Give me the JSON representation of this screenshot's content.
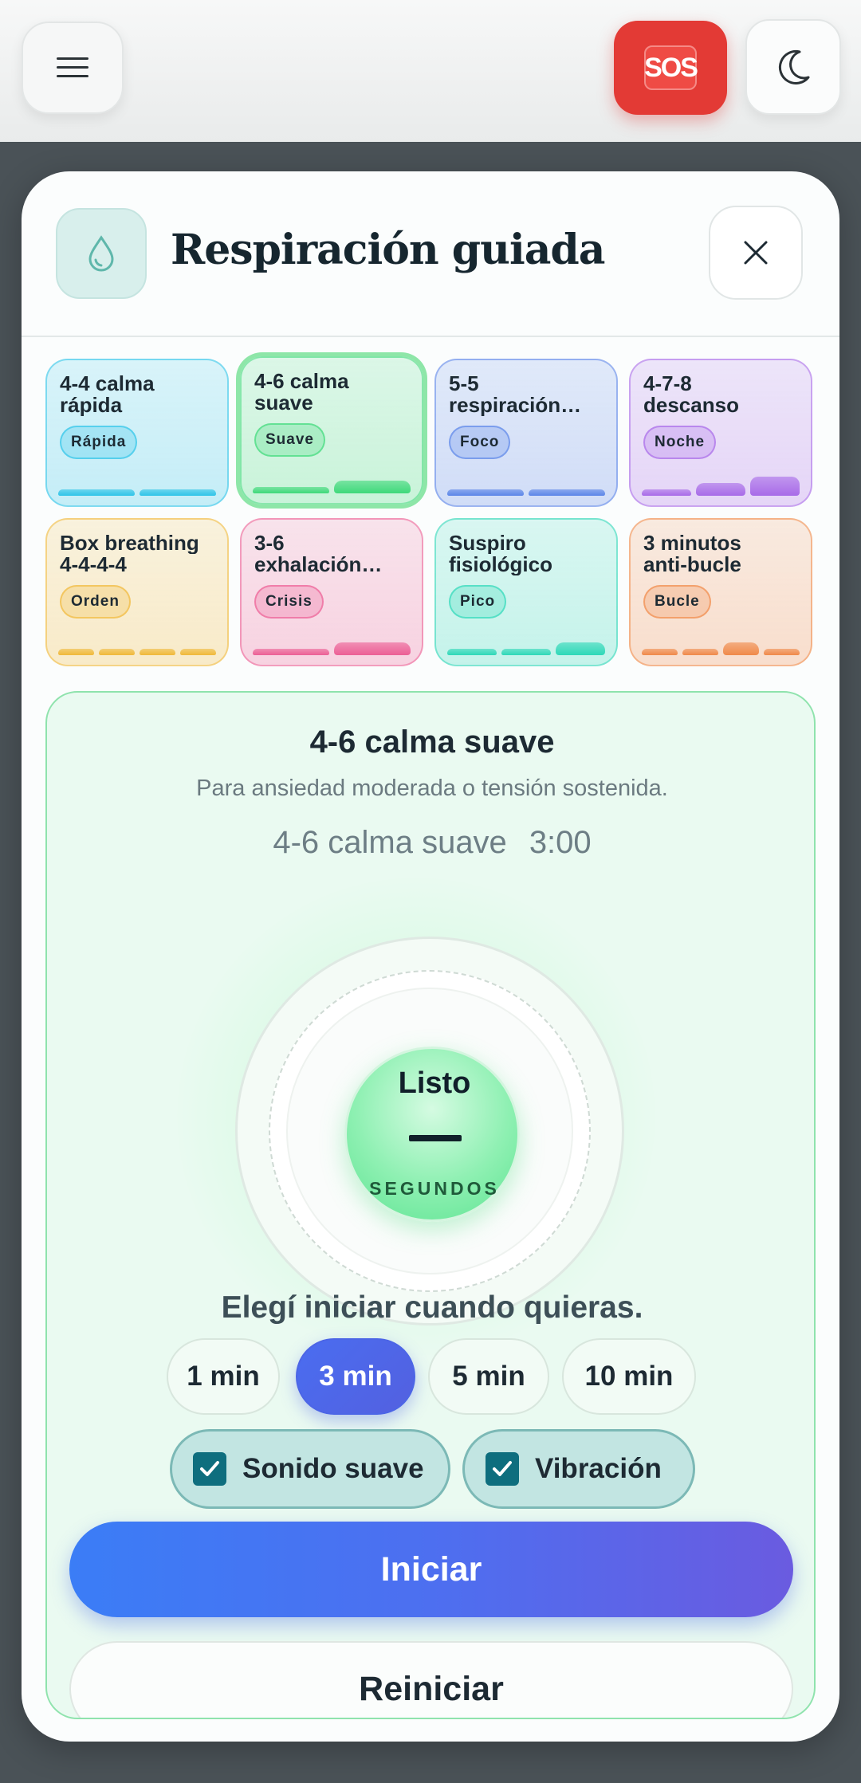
{
  "topbar": {
    "menu_icon": "hamburger-menu-icon",
    "sos_label": "SOS",
    "theme_icon": "moon-icon"
  },
  "modal": {
    "title": "Respiración guiada",
    "header_icon": "water-drop-icon",
    "close_icon": "close-icon"
  },
  "techniques": [
    {
      "title_line1": "4-4 calma",
      "title_line2": "rápida",
      "badge": "Rápida",
      "color": "#2ec4e8",
      "selected": false
    },
    {
      "title_line1": "4-6 calma",
      "title_line2": "suave",
      "badge": "Suave",
      "color": "#3fd97a",
      "selected": true
    },
    {
      "title_line1": "5-5",
      "title_line2": "respiración…",
      "badge": "Foco",
      "color": "#5b86e8",
      "selected": false
    },
    {
      "title_line1": "4-7-8",
      "title_line2": "descanso",
      "badge": "Noche",
      "color": "#a86be8",
      "selected": false
    },
    {
      "title_line1": "Box breathing",
      "title_line2": "4-4-4-4",
      "badge": "Orden",
      "color": "#f0b93a",
      "selected": false
    },
    {
      "title_line1": "3-6",
      "title_line2": "exhalación…",
      "badge": "Crisis",
      "color": "#ec5f95",
      "selected": false
    },
    {
      "title_line1": "Suspiro",
      "title_line2": "fisiológico",
      "badge": "Pico",
      "color": "#2fd8b8",
      "selected": false
    },
    {
      "title_line1": "3 minutos",
      "title_line2": "anti-bucle",
      "badge": "Bucle",
      "color": "#f08a4a",
      "selected": false
    }
  ],
  "player": {
    "title": "4-6 calma suave",
    "subtitle": "Para ansiedad moderada o tensión sostenida.",
    "technique_name": "4-6 calma suave",
    "time": "3:00",
    "state_label": "Listo",
    "counter": "—",
    "unit_label": "SEGUNDOS",
    "hint": "Elegí iniciar cuando quieras.",
    "durations": [
      "1 min",
      "3 min",
      "5 min",
      "10 min"
    ],
    "selected_duration": "3 min",
    "options": [
      {
        "label": "Sonido suave",
        "checked": true
      },
      {
        "label": "Vibración",
        "checked": true
      }
    ],
    "start_label": "Iniciar",
    "reset_label": "Reiniciar"
  }
}
